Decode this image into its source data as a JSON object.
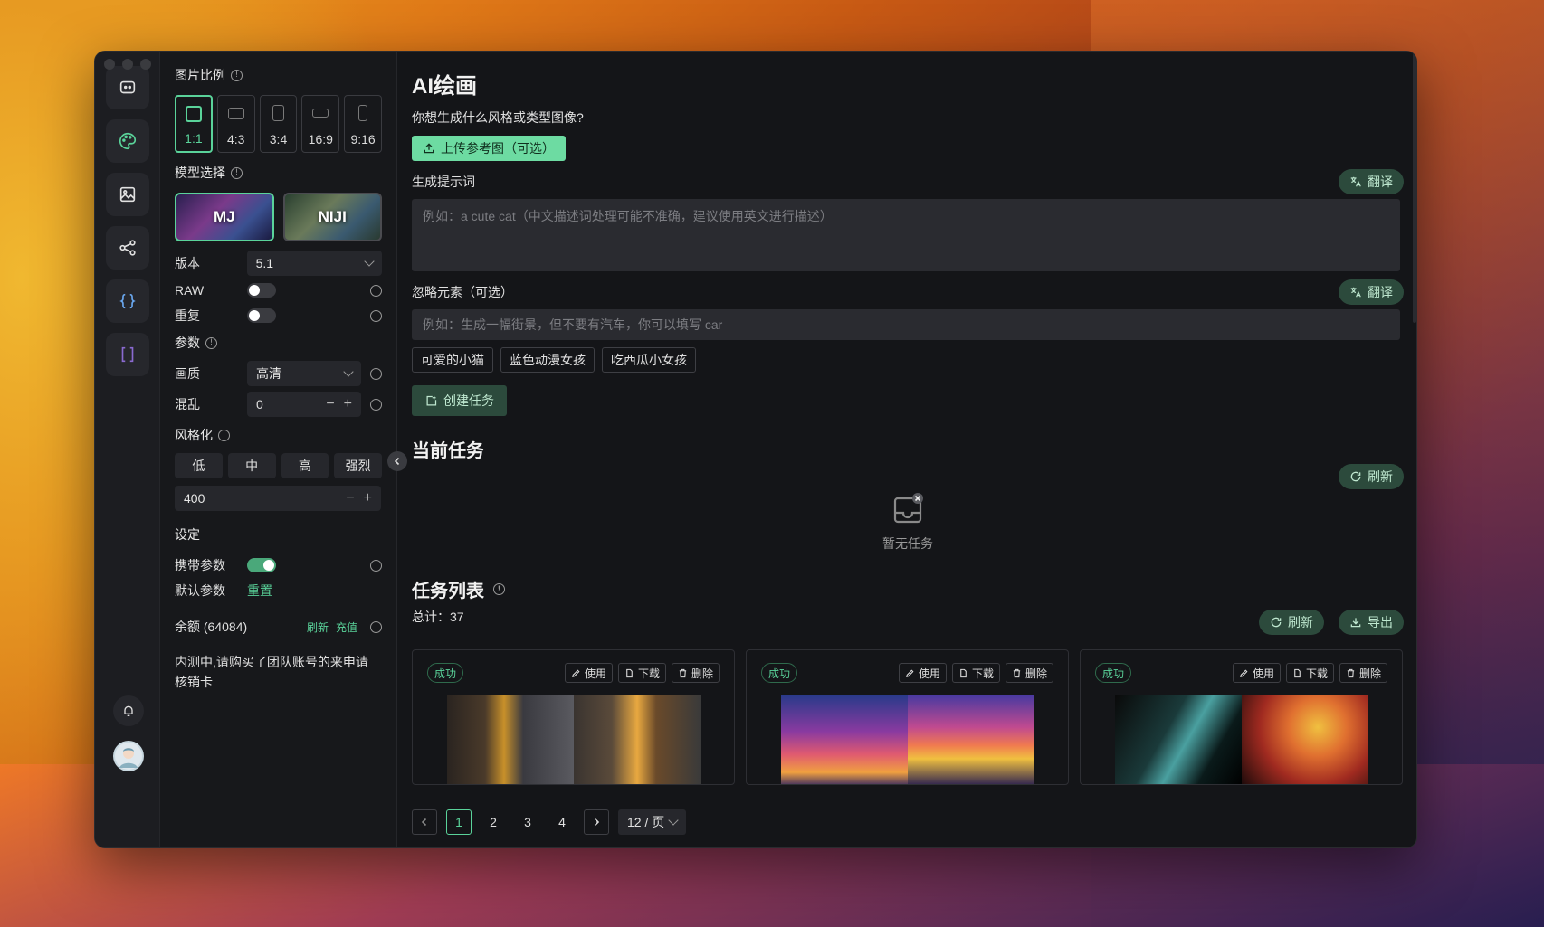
{
  "panel": {
    "ratio_title": "图片比例",
    "ratios": [
      "1:1",
      "4:3",
      "3:4",
      "16:9",
      "9:16"
    ],
    "model_title": "模型选择",
    "models": [
      "MJ",
      "NIJI"
    ],
    "version_label": "版本",
    "version_value": "5.1",
    "raw_label": "RAW",
    "repeat_label": "重复",
    "params_title": "参数",
    "quality_label": "画质",
    "quality_value": "高清",
    "chaos_label": "混乱",
    "chaos_value": "0",
    "stylize_title": "风格化",
    "stylize_options": [
      "低",
      "中",
      "高",
      "强烈"
    ],
    "stylize_value": "400",
    "settings_title": "设定",
    "carry_params_label": "携带参数",
    "default_params_label": "默认参数",
    "reset_link": "重置",
    "balance_label": "余额 (64084)",
    "refresh_link": "刷新",
    "recharge_link": "充值",
    "notice": "内测中,请购买了团队账号的来申请核销卡"
  },
  "main": {
    "title": "AI绘画",
    "question": "你想生成什么风格或类型图像?",
    "upload_btn": "上传参考图（可选）",
    "prompt_label": "生成提示词",
    "translate_btn": "翻译",
    "prompt_placeholder": "例如：a cute cat（中文描述词处理可能不准确，建议使用英文进行描述）",
    "negative_label": "忽略元素（可选）",
    "negative_placeholder": "例如：生成一幅街景，但不要有汽车，你可以填写 car",
    "tags": [
      "可爱的小猫",
      "蓝色动漫女孩",
      "吃西瓜小女孩"
    ],
    "create_btn": "创建任务",
    "current_title": "当前任务",
    "refresh_btn": "刷新",
    "empty_text": "暂无任务",
    "list_title": "任务列表",
    "total": "总计：37",
    "export_btn": "导出",
    "cards": [
      {
        "status": "成功",
        "use": "使用",
        "download": "下载",
        "delete": "删除"
      },
      {
        "status": "成功",
        "use": "使用",
        "download": "下载",
        "delete": "删除"
      },
      {
        "status": "成功",
        "use": "使用",
        "download": "下载",
        "delete": "删除"
      }
    ],
    "pages": [
      "1",
      "2",
      "3",
      "4"
    ],
    "page_size": "12 / 页"
  },
  "colors": {
    "accent": "#5ad39a",
    "accent_dark": "#2c4a3c",
    "upload_bg": "#6ddba2"
  }
}
